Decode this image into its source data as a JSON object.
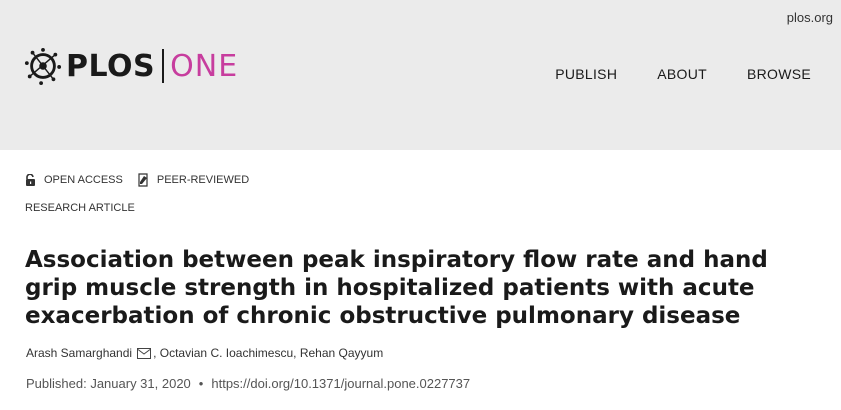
{
  "header": {
    "site_link": "plos.org",
    "logo": {
      "plos": "PLOS",
      "one": "ONE",
      "accent_color": "#c73d9e"
    },
    "nav": [
      {
        "label": "PUBLISH"
      },
      {
        "label": "ABOUT"
      },
      {
        "label": "BROWSE"
      }
    ]
  },
  "badges": [
    {
      "label": "OPEN ACCESS",
      "icon": "open-lock-icon"
    },
    {
      "label": "PEER-REVIEWED",
      "icon": "peer-reviewed-icon"
    }
  ],
  "article": {
    "type": "RESEARCH ARTICLE",
    "title": "Association between peak inspiratory flow rate and hand grip muscle strength in hospitalized patients with acute exacerbation of chronic obstructive pulmonary disease",
    "authors": [
      {
        "name": "Arash Samarghandi",
        "corresponding": true
      },
      {
        "name": "Octavian C. Ioachimescu"
      },
      {
        "name": "Rehan Qayyum"
      }
    ],
    "author_separator": ",",
    "published": "Published: January 31, 2020",
    "bullet": "•",
    "doi": "https://doi.org/10.1371/journal.pone.0227737"
  }
}
